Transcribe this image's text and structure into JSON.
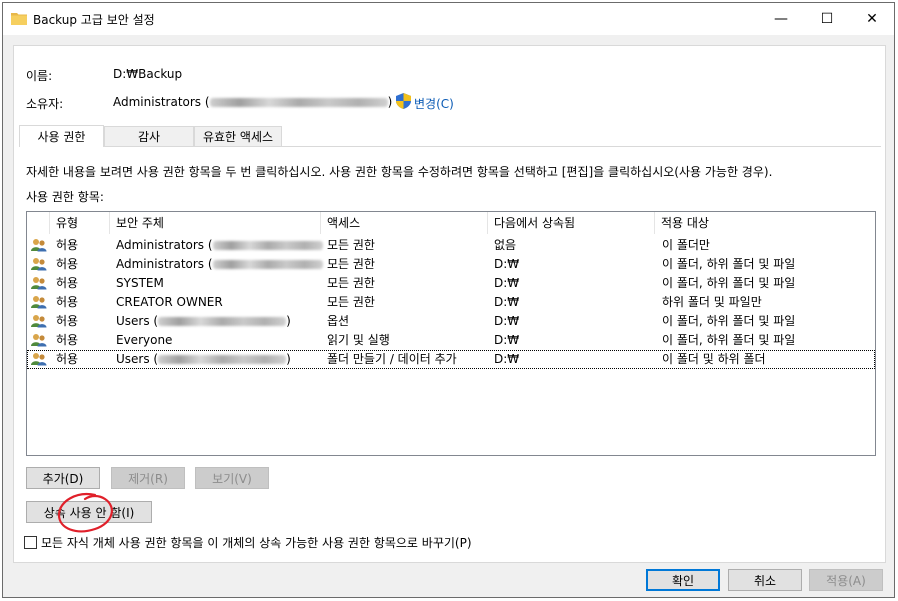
{
  "window": {
    "title": "Backup 고급 보안 설정",
    "minimize_glyph": "—",
    "maximize_glyph": "☐",
    "close_glyph": "✕"
  },
  "owner_info": {
    "name_label": "이름:",
    "name_value": "D:₩Backup",
    "owner_label": "소유자:",
    "owner_value": "Administrators (",
    "owner_suffix": ")",
    "change_link": "변경(C)"
  },
  "tabs": [
    {
      "label": "사용 권한",
      "active": true
    },
    {
      "label": "감사",
      "active": false
    },
    {
      "label": "유효한 액세스",
      "active": false
    }
  ],
  "instructions": "자세한 내용을 보려면 사용 권한 항목을 두 번 클릭하십시오. 사용 권한 항목을 수정하려면 항목을 선택하고 [편집]을 클릭하십시오(사용 가능한 경우).",
  "list_label": "사용 권한 항목:",
  "table": {
    "headers": [
      "유형",
      "보안 주체",
      "액세스",
      "다음에서 상속됨",
      "적용 대상"
    ],
    "rows": [
      {
        "type": "허용",
        "principal": "Administrators (",
        "principal_blurred": true,
        "access": "모든 권한",
        "inherited": "없음",
        "applies": "이 폴더만"
      },
      {
        "type": "허용",
        "principal": "Administrators (",
        "principal_blurred": true,
        "access": "모든 권한",
        "inherited": "D:₩",
        "applies": "이 폴더, 하위 폴더 및 파일"
      },
      {
        "type": "허용",
        "principal": "SYSTEM",
        "principal_blurred": false,
        "access": "모든 권한",
        "inherited": "D:₩",
        "applies": "이 폴더, 하위 폴더 및 파일"
      },
      {
        "type": "허용",
        "principal": "CREATOR OWNER",
        "principal_blurred": false,
        "access": "모든 권한",
        "inherited": "D:₩",
        "applies": "하위 폴더 및 파일만"
      },
      {
        "type": "허용",
        "principal": "Users (",
        "principal_blurred": true,
        "principal_close": ")",
        "access": "옵션",
        "inherited": "D:₩",
        "applies": "이 폴더, 하위 폴더 및 파일"
      },
      {
        "type": "허용",
        "principal": "Everyone",
        "principal_blurred": false,
        "access": "읽기 및 실행",
        "inherited": "D:₩",
        "applies": "이 폴더, 하위 폴더 및 파일"
      },
      {
        "type": "허용",
        "principal": "Users (",
        "principal_blurred": true,
        "principal_close": ")",
        "access": "폴더 만들기 / 데이터 추가",
        "inherited": "D:₩",
        "applies": "이 폴더 및 하위 폴더",
        "selected": true
      }
    ]
  },
  "buttons": {
    "add": "추가(D)",
    "remove": "제거(R)",
    "view": "보기(V)",
    "disable_inheritance": "상속 사용 안 함(I)",
    "ok": "확인",
    "cancel": "취소",
    "apply": "적용(A)"
  },
  "replace_checkbox": {
    "label": "모든 자식 개체 사용 권한 항목을 이 개체의 상속 가능한 사용 권한 항목으로 바꾸기(P)",
    "checked": false
  },
  "colors": {
    "link": "#0b5bb5",
    "annotation": "#e0202a",
    "default_button_border": "#0078d7"
  }
}
